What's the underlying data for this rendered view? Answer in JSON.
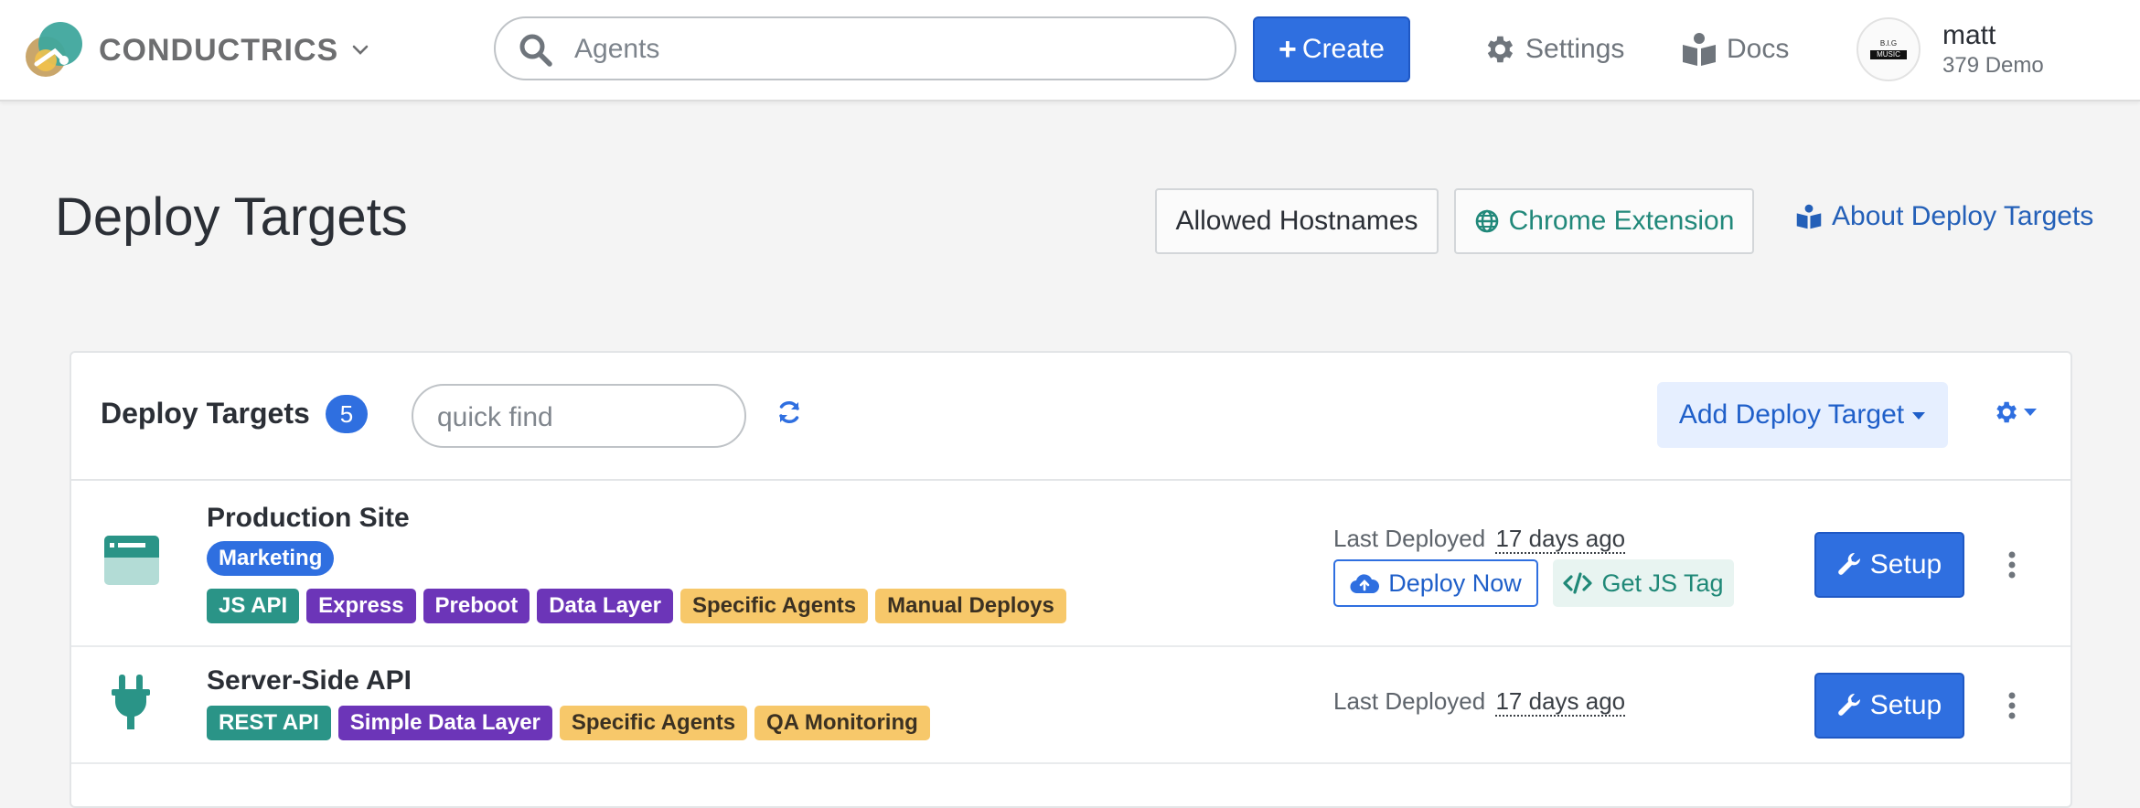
{
  "nav": {
    "brand": "CONDUCTRICS",
    "search_value": "",
    "search_placeholder": "Agents",
    "create_label": "Create",
    "settings_label": "Settings",
    "docs_label": "Docs",
    "user_name": "matt",
    "user_org": "379 Demo",
    "avatar_text_top": "B.I.G",
    "avatar_text_bottom": "MUSIC"
  },
  "page": {
    "title": "Deploy Targets",
    "allowed_hostnames": "Allowed Hostnames",
    "chrome_extension": "Chrome Extension",
    "about": "About Deploy Targets"
  },
  "card": {
    "title": "Deploy Targets",
    "count": "5",
    "quick_find_placeholder": "quick find",
    "add_target_label": "Add Deploy Target"
  },
  "rows": [
    {
      "name": "Production Site",
      "category": "Marketing",
      "tags": [
        "JS API",
        "Express",
        "Preboot",
        "Data Layer",
        "Specific Agents",
        "Manual Deploys"
      ],
      "last_deployed_label": "Last Deployed",
      "last_deployed_value": "17 days ago",
      "deploy_now_label": "Deploy Now",
      "js_tag_label": "Get JS Tag",
      "setup_label": "Setup"
    },
    {
      "name": "Server-Side API",
      "tags": [
        "REST API",
        "Simple Data Layer",
        "Specific Agents",
        "QA Monitoring"
      ],
      "last_deployed_label": "Last Deployed",
      "last_deployed_value": "17 days ago",
      "setup_label": "Setup"
    }
  ],
  "colors": {
    "primary": "#2f6fe0",
    "teal_tag": "#2a9487",
    "purple_tag": "#6c35b8",
    "yellow_tag": "#f7c86a",
    "link_blue": "#2460b8",
    "chrome_teal": "#21887a"
  }
}
